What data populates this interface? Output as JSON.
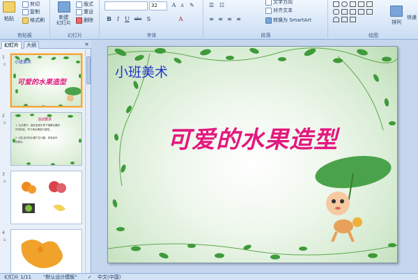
{
  "ribbon": {
    "clipboard": {
      "label": "剪贴板",
      "paste": "粘贴",
      "cut": "剪切",
      "copy": "复制",
      "format_painter": "格式刷"
    },
    "slides": {
      "label": "幻灯片",
      "new_slide": "新建\n幻灯片",
      "layout": "版式",
      "reset": "重设",
      "delete": "删除"
    },
    "font": {
      "label": "字体",
      "font_name": "",
      "font_size": "32",
      "bold": "B",
      "italic": "I",
      "underline": "U",
      "strike": "abc",
      "shadow": "S"
    },
    "paragraph": {
      "label": "段落",
      "text_direction": "文字方向",
      "align_text": "对齐文本",
      "smartart": "转换为 SmartArt"
    },
    "drawing": {
      "label": "绘图",
      "arrange": "排列",
      "quick_styles": "快速"
    }
  },
  "left_pane": {
    "tabs": [
      "幻灯片",
      "大纲"
    ],
    "close": "×",
    "slide_numbers": [
      "1",
      "2",
      "3",
      "4"
    ],
    "star": "✩",
    "thumb1": {
      "subtitle": "小班美术",
      "title": "可爱的水果造型"
    },
    "thumb2": {
      "heading": "活动要求",
      "lines": [
        "1. 认识橘子，能在老师引导下观察水果的",
        "外形特征，学习用水果进行造型。",
        "2. 对生活中的水果产生兴趣，体验创作",
        "的快乐。"
      ]
    }
  },
  "slide": {
    "subtitle": "小班美术",
    "title": "可爱的水果造型"
  },
  "status_bar": {
    "slide_info": "幻灯片 1/11",
    "theme": "\"默认设计模板\"",
    "language": "中文(中国)"
  }
}
